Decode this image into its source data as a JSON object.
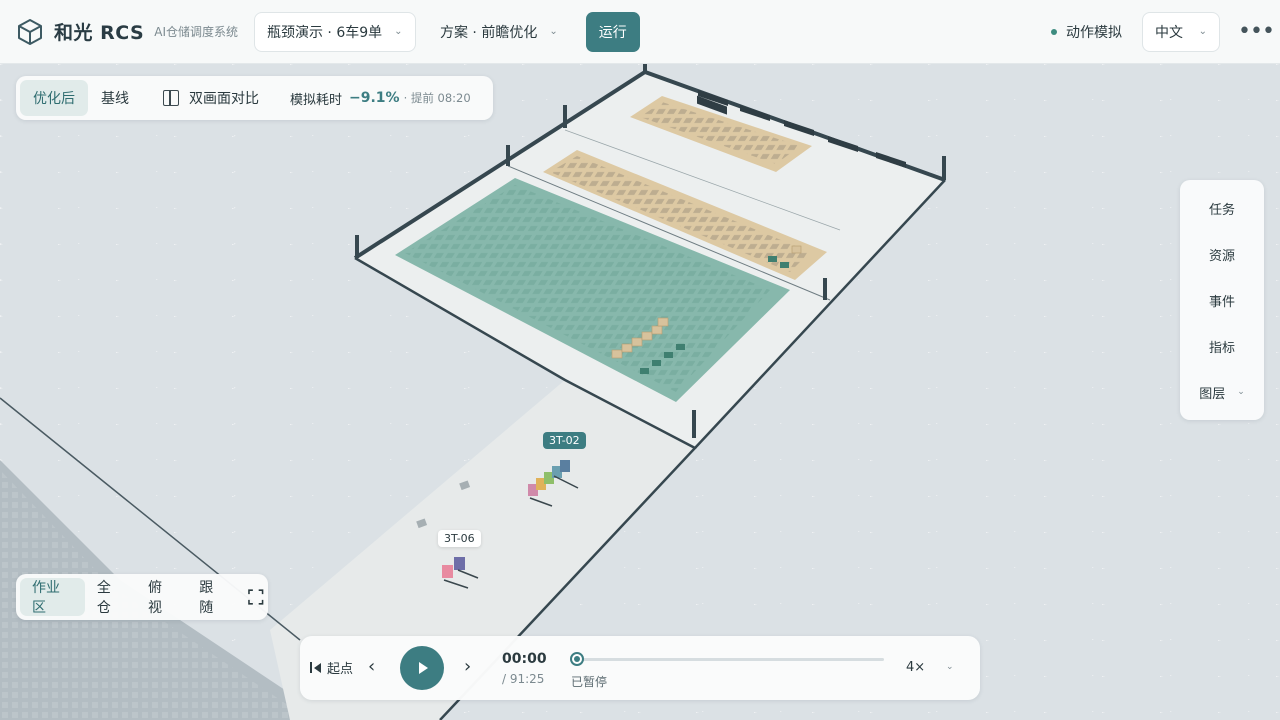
{
  "header": {
    "brand": "和光 RCS",
    "subtitle": "AI仓储调度系统",
    "scenario": "瓶颈演示 · 6车9单",
    "plan": "方案 · 前瞻优化",
    "run_label": "运行",
    "sim_mode": "动作模拟",
    "language": "中文",
    "more_icon": "more-horizontal-icon"
  },
  "view_toggle": {
    "optimized": "优化后",
    "baseline": "基线",
    "split_compare": "双画面对比",
    "metric_label": "模拟耗时",
    "metric_delta": "−9.1%",
    "metric_ahead": "· 提前 08:20"
  },
  "sidenav": {
    "items": [
      "任务",
      "资源",
      "事件",
      "指标",
      "图层"
    ]
  },
  "camera": {
    "work_area": "作业区",
    "whole_warehouse": "全仓",
    "top_view": "俯视",
    "follow": "跟随"
  },
  "playback": {
    "start_label": "起点",
    "current_time": "00:00",
    "total_time": "/ 91:25",
    "status": "已暂停",
    "speed": "4×",
    "progress": 0
  },
  "scene": {
    "vehicle_tags": [
      "3T-02",
      "3T-06"
    ]
  },
  "colors": {
    "accent": "#3d7d82",
    "storage_zone": "#87b8ac",
    "staging_zone": "#ddc9a3"
  }
}
